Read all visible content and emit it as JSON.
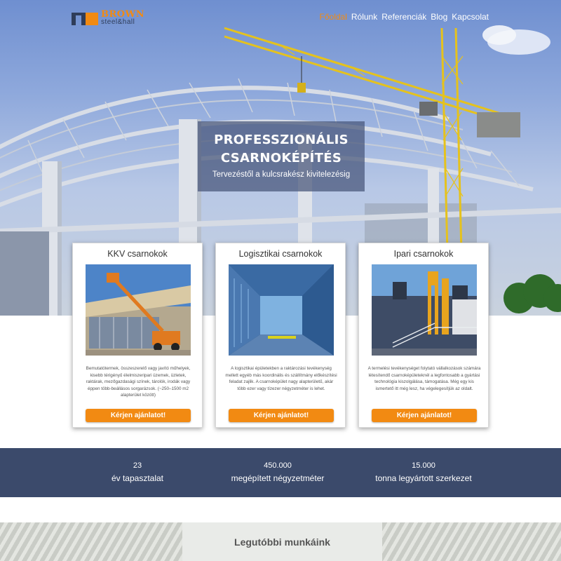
{
  "header": {
    "logo": {
      "brand": "BROWN",
      "sub": "steel&hall"
    },
    "nav": [
      {
        "label": "Főoldal",
        "active": true
      },
      {
        "label": "Rólunk",
        "active": false
      },
      {
        "label": "Referenciák",
        "active": false
      },
      {
        "label": "Blog",
        "active": false
      },
      {
        "label": "Kapcsolat",
        "active": false
      }
    ]
  },
  "hero": {
    "title_line1": "PROFESSZIONÁLIS",
    "title_line2": "CSARNOKÉPÍTÉS",
    "subtitle": "Tervezéstől a kulcsrakész kivitelezésig"
  },
  "cards": [
    {
      "title": "KKV csarnokok",
      "description": "Bemutatótermek, összeszerelő vagy javító műhelyek, kisebb térigényű élelmiszeripari üzemek, üzletek, raktárak, mezőgazdasági színek, tárolók, irodák vagy éppen több-beállásos sorgarázsok. (~250–1500 m2 alapterület között)",
      "cta": "Kérjen ajánlatot!"
    },
    {
      "title": "Logisztikai csarnokok",
      "description": "A logisztikai épületekben a raktározási tevékenység mellett egyéb más koordinális és szállítmány előkészítési feladat zajlik. A csarnoképület nagy alapterületű, akár több ezer vagy tízezer négyzetméter is lehet.",
      "cta": "Kérjen ajánlatot!"
    },
    {
      "title": "Ipari csarnokok",
      "description": "A termelési tevékenységet folytató vállalkozások számára létesítendő csarnoképületeknél a legfontosabb a gyártási technológia kiszolgálása, támogatása. Még egy kis ismertető itt még lesz, ha végelegesítjük az oldalt.",
      "cta": "Kérjen ajánlatot!"
    }
  ],
  "stats": [
    {
      "value": "23",
      "label": "év tapasztalat"
    },
    {
      "value": "450.000",
      "label": "megépített négyzetméter"
    },
    {
      "value": "15.000",
      "label": "tonna legyártott szerkezet"
    }
  ],
  "recent": {
    "title": "Legutóbbi munkáink"
  },
  "colors": {
    "accent": "#f28a12",
    "navy": "#3b4a6b"
  }
}
